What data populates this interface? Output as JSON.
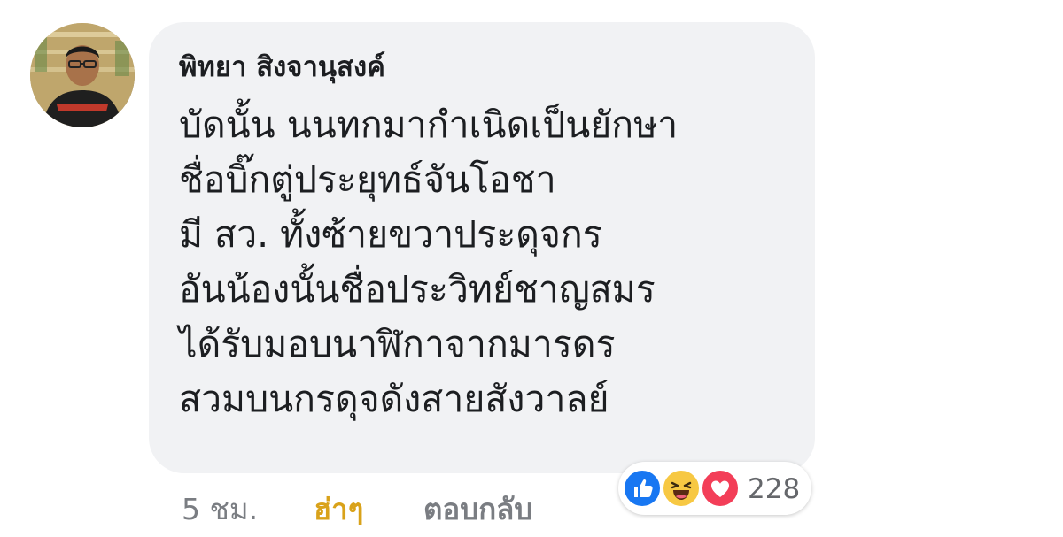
{
  "comment": {
    "author": "พิทยา สิงจานุสงค์",
    "lines": [
      "บัดนั้น นนทกมากำเนิดเป็นยักษา",
      "ชื่อบิ๊กตู่ประยุทธ์จันโอชา",
      "มี สว. ทั้งซ้ายขวาประดุจกร",
      "อันน้องนั้นชื่อประวิทย์ชาญสมร",
      "ได้รับมอบนาฬิกาจากมารดร",
      "สวมบนกรดุจดังสายสังวาลย์"
    ],
    "timestamp": "5 ชม.",
    "reaction_link": "ฮ่าๆ",
    "reply_link": "ตอบกลับ",
    "reactions": {
      "icons": [
        "like-icon",
        "haha-icon",
        "love-icon"
      ],
      "count": "228"
    }
  },
  "colors": {
    "bubble": "#f1f2f4",
    "author": "#1c1e21",
    "meta": "#7a7d82",
    "haha_link": "#d9a21a",
    "like": "#1877f2",
    "haha": "#f7c843",
    "love": "#f33e58"
  }
}
